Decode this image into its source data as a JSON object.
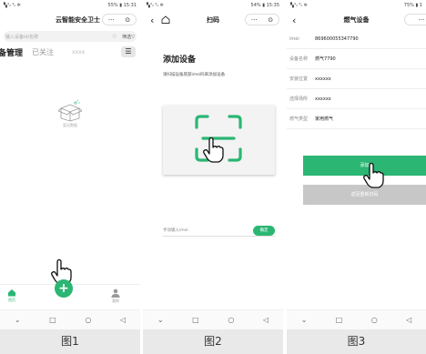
{
  "screen1": {
    "status_left": "▚⁴ᵢₗ ⁴ᵢₗ ✲",
    "status_right": "55% ▮ 15:31",
    "title": "云智能安全卫士",
    "capsule_more": "···",
    "search_placeholder": "输入设备id/名称",
    "filter_label": "筛选▽",
    "tab_active": "备管理",
    "tab_follow": "已关注",
    "tab_other": "xxxx",
    "empty_text": "暂无数据",
    "tab_home": "首页",
    "tab_mine": "我的",
    "fab_symbol": "+"
  },
  "screen2": {
    "status_left": "▚⁴ᵢₗ ⁴ᵢₗ ✲",
    "status_right": "54% ▮ 15:35",
    "title": "扫码",
    "capsule_more": "···",
    "heading": "添加设备",
    "subheading": "请扫描设备底部imei码来添加设备",
    "imei_placeholder": "手动输入imei",
    "confirm_button": "确定"
  },
  "screen3": {
    "status_left": "▚⁴ᵢₗ ⁴ᵢₗ ✲",
    "status_right": "75% ▮ 1",
    "title": "燃气设备",
    "capsule_more": "···",
    "fields": [
      {
        "label": "imei",
        "value": "869600055347790"
      },
      {
        "label": "设备名称",
        "value": "燃气7790"
      },
      {
        "label": "安装位置",
        "value": "xxxxxx"
      },
      {
        "label": "选择场所",
        "value": "xxxxxx"
      },
      {
        "label": "燃气类型",
        "value": "家用燃气"
      }
    ],
    "add_button": "添加",
    "rescan_button": "返回重新扫码"
  },
  "captions": [
    "图1",
    "图2",
    "图3"
  ],
  "colors": {
    "accent": "#2bb673",
    "caption_bg": "#e9e9e9"
  }
}
